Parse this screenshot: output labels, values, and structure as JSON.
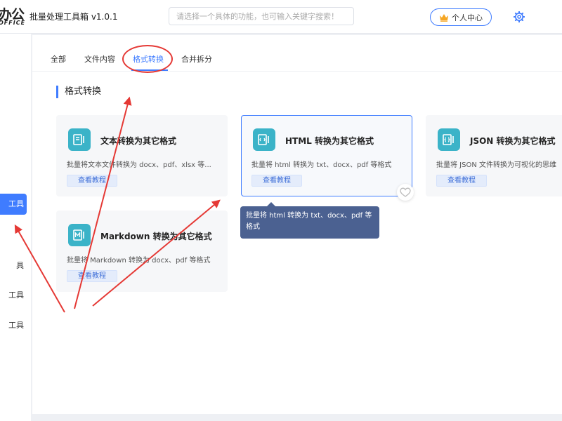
{
  "header": {
    "logo_main": "办公",
    "logo_sub": "OFFICE",
    "app_name": "批量处理工具箱 v1.0.1",
    "search_placeholder": "请选择一个具体的功能，也可输入关键字搜索！",
    "user_center": "个人中心",
    "crown_icon": "crown-icon",
    "settings_icon": "gear-icon"
  },
  "sidebar": {
    "items": [
      {
        "label": "工具",
        "active": true
      },
      {
        "label": "具",
        "active": false
      },
      {
        "label": "工具",
        "active": false
      },
      {
        "label": "工具",
        "active": false
      }
    ]
  },
  "tabs": [
    {
      "label": "全部",
      "active": false
    },
    {
      "label": "文件内容",
      "active": false
    },
    {
      "label": "格式转换",
      "active": true
    },
    {
      "label": "合并拆分",
      "active": false
    }
  ],
  "section_title": "格式转换",
  "cards": [
    {
      "title": "文本转换为其它格式",
      "desc": "批量将文本文件转换为 docx、pdf、xlsx 等...",
      "button": "查看教程",
      "icon": "text-file-icon"
    },
    {
      "title": "HTML 转换为其它格式",
      "desc": "批量将 html 转换为 txt、docx、pdf 等格式",
      "button": "查看教程",
      "icon": "html-file-icon"
    },
    {
      "title": "JSON 转换为其它格式",
      "desc": "批量将 JSON 文件转换为可视化的思维",
      "button": "查看教程",
      "icon": "json-file-icon"
    },
    {
      "title": "Markdown 转换为其它格式",
      "desc": "批量将 Markdown 转换为 docx、pdf 等格式",
      "button": "查看教程",
      "icon": "markdown-file-icon"
    }
  ],
  "tooltip": "批量将 html 转换为 txt、docx、pdf 等格式",
  "colors": {
    "accent": "#3f7cff",
    "icon_teal": "#3bb3c8",
    "annotation_red": "#e53935",
    "tooltip_bg": "#4b6191"
  }
}
